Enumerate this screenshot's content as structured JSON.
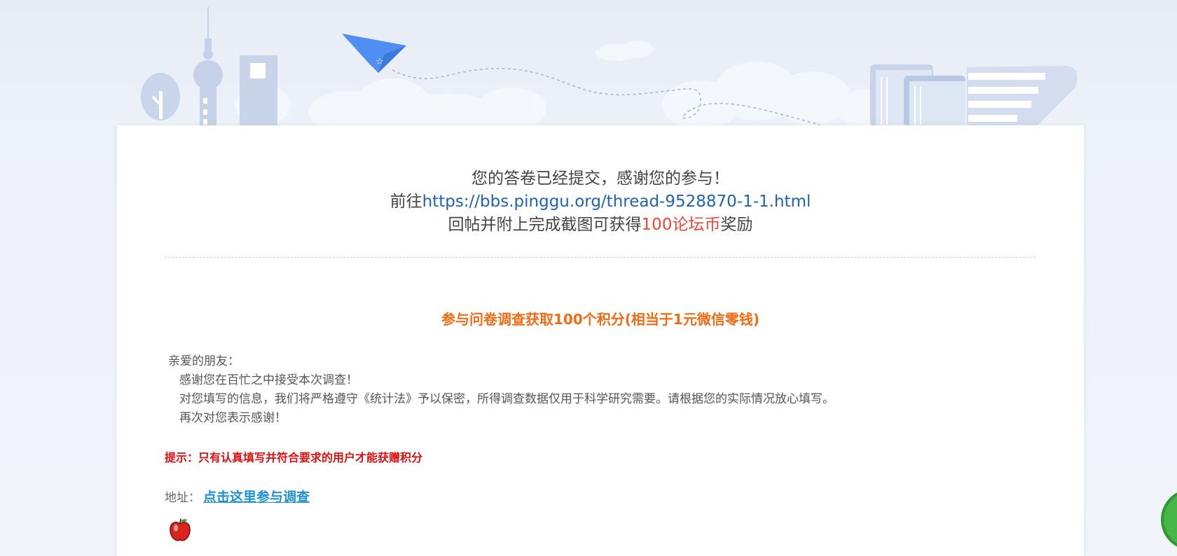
{
  "result": {
    "line1": "您的答卷已经提交，感谢您的参与！",
    "line2_prefix": "前往",
    "line2_link": "https://bbs.pinggu.org/thread-9528870-1-1.html",
    "line3_prefix": "回帖并附上完成截图可获得",
    "line3_reward": "100论坛币",
    "line3_suffix": "奖励"
  },
  "survey": {
    "title": "参与问卷调查获取100个积分(相当于1元微信零钱)",
    "greeting": "亲爱的朋友：",
    "paragraphs": [
      "感谢您在百忙之中接受本次调查！",
      "对您填写的信息，我们将严格遵守《统计法》予以保密，所得调查数据仅用于科学研究需要。请根据您的实际情况放心填写。",
      "再次对您表示感谢！"
    ],
    "tip": "提示：只有认真填写并符合要求的用户才能获赠积分",
    "address_label": "地址：",
    "address_link": "点击这里参与调查"
  },
  "colors": {
    "accent_link": "#1d63b8",
    "reward_red": "#f0453a",
    "title_orange": "#f36b12",
    "tip_red": "#e01010",
    "survey_link": "#1e90d8"
  },
  "icons": [
    "paper-plane-icon",
    "apple-icon",
    "back-to-top-icon"
  ]
}
